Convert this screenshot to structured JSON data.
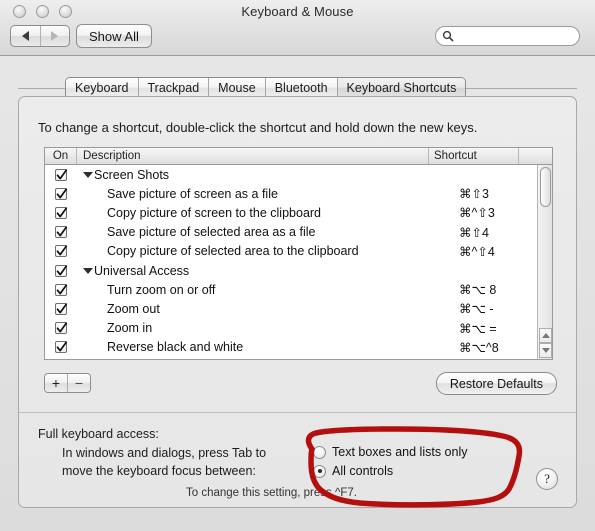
{
  "window": {
    "title": "Keyboard & Mouse",
    "traffic_lights": [
      "close",
      "minimize",
      "zoom"
    ]
  },
  "toolbar": {
    "back_label": "Back",
    "forward_label": "Forward",
    "show_all_label": "Show All",
    "search_placeholder": "",
    "search_value": "",
    "search_icon": "search-icon"
  },
  "tabs": [
    {
      "label": "Keyboard",
      "selected": false
    },
    {
      "label": "Trackpad",
      "selected": false
    },
    {
      "label": "Mouse",
      "selected": false
    },
    {
      "label": "Bluetooth",
      "selected": false
    },
    {
      "label": "Keyboard Shortcuts",
      "selected": true
    }
  ],
  "instruction": "To change a shortcut, double-click the shortcut and hold down the new keys.",
  "table": {
    "columns": [
      "On",
      "Description",
      "Shortcut",
      ""
    ],
    "rows": [
      {
        "type": "group",
        "checked": true,
        "description": "Screen Shots",
        "shortcut": ""
      },
      {
        "type": "child",
        "checked": true,
        "description": "Save picture of screen as a file",
        "shortcut": "⌘⇧3"
      },
      {
        "type": "child",
        "checked": true,
        "description": "Copy picture of screen to the clipboard",
        "shortcut": "⌘^⇧3"
      },
      {
        "type": "child",
        "checked": true,
        "description": "Save picture of selected area as a file",
        "shortcut": "⌘⇧4"
      },
      {
        "type": "child",
        "checked": true,
        "description": "Copy picture of selected area to the clipboard",
        "shortcut": "⌘^⇧4"
      },
      {
        "type": "group",
        "checked": true,
        "description": "Universal Access",
        "shortcut": ""
      },
      {
        "type": "child",
        "checked": true,
        "description": "Turn zoom on or off",
        "shortcut": "⌘⌥ 8"
      },
      {
        "type": "child",
        "checked": true,
        "description": "Zoom out",
        "shortcut": "⌘⌥ -"
      },
      {
        "type": "child",
        "checked": true,
        "description": "Zoom in",
        "shortcut": "⌘⌥ ="
      },
      {
        "type": "child",
        "checked": true,
        "description": "Reverse black and white",
        "shortcut": "⌘⌥^8"
      }
    ]
  },
  "actions": {
    "add_label": "+",
    "remove_label": "−",
    "restore_defaults_label": "Restore Defaults"
  },
  "full_keyboard_access": {
    "title": "Full keyboard access:",
    "description_line1": "In windows and dialogs, press Tab to",
    "description_line2": "move the keyboard focus between:",
    "options": [
      {
        "label": "Text boxes and lists only",
        "selected": false
      },
      {
        "label": "All controls",
        "selected": true
      }
    ],
    "hint": "To change this setting, press ^F7."
  },
  "help_button_label": "?",
  "annotation": {
    "type": "hand-drawn-circle",
    "color": "#b40f0f"
  }
}
